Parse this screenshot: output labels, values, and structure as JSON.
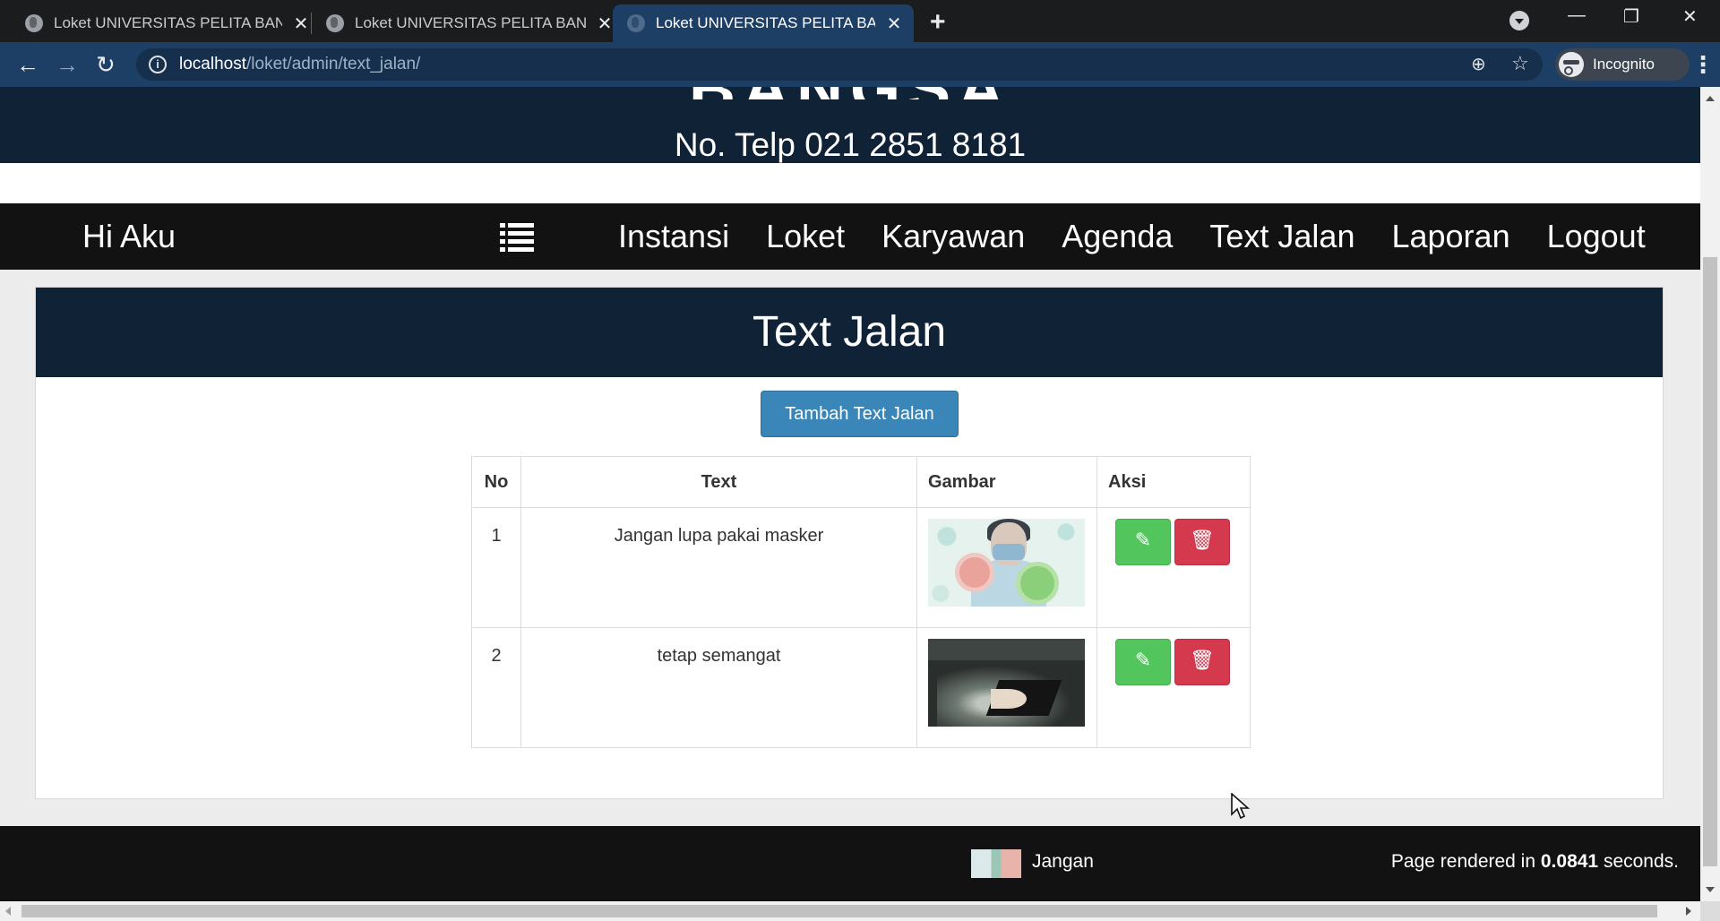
{
  "browser": {
    "tabs": [
      {
        "title": "Loket UNIVERSITAS PELITA BANGSA",
        "active": false
      },
      {
        "title": "Loket UNIVERSITAS PELITA BANGSA",
        "active": false
      },
      {
        "title": "Loket UNIVERSITAS PELITA BANGSA",
        "active": true
      }
    ],
    "url_host": "localhost",
    "url_path": "/loket/admin/text_jalan/",
    "incognito_label": "Incognito"
  },
  "header": {
    "big_title": "BANGSA",
    "phone": "No. Telp 021 2851 8181"
  },
  "nav": {
    "greeting": "Hi Aku",
    "links": [
      "Instansi",
      "Loket",
      "Karyawan",
      "Agenda",
      "Text Jalan",
      "Laporan",
      "Logout"
    ]
  },
  "card": {
    "title": "Text Jalan",
    "add_button": "Tambah Text Jalan"
  },
  "table": {
    "headers": {
      "no": "No",
      "text": "Text",
      "gambar": "Gambar",
      "aksi": "Aksi"
    },
    "rows": [
      {
        "no": "1",
        "text": "Jangan lupa pakai masker",
        "image": "masker-image"
      },
      {
        "no": "2",
        "text": "tetap semangat",
        "image": "book-image"
      }
    ]
  },
  "footer": {
    "marquee_text": "Jangan",
    "rendered_prefix": "Page rendered in ",
    "rendered_time": "0.0841",
    "rendered_suffix": " seconds."
  },
  "colors": {
    "dark_navy": "#0f2236",
    "navbar": "#121212",
    "add_button": "#3b86b8",
    "edit_button": "#52c65c",
    "delete_button": "#d4394e",
    "browser_toolbar": "#1d3f66"
  },
  "icons": {
    "menu": "list-icon",
    "edit": "pencil-icon",
    "delete": "trash-icon"
  }
}
